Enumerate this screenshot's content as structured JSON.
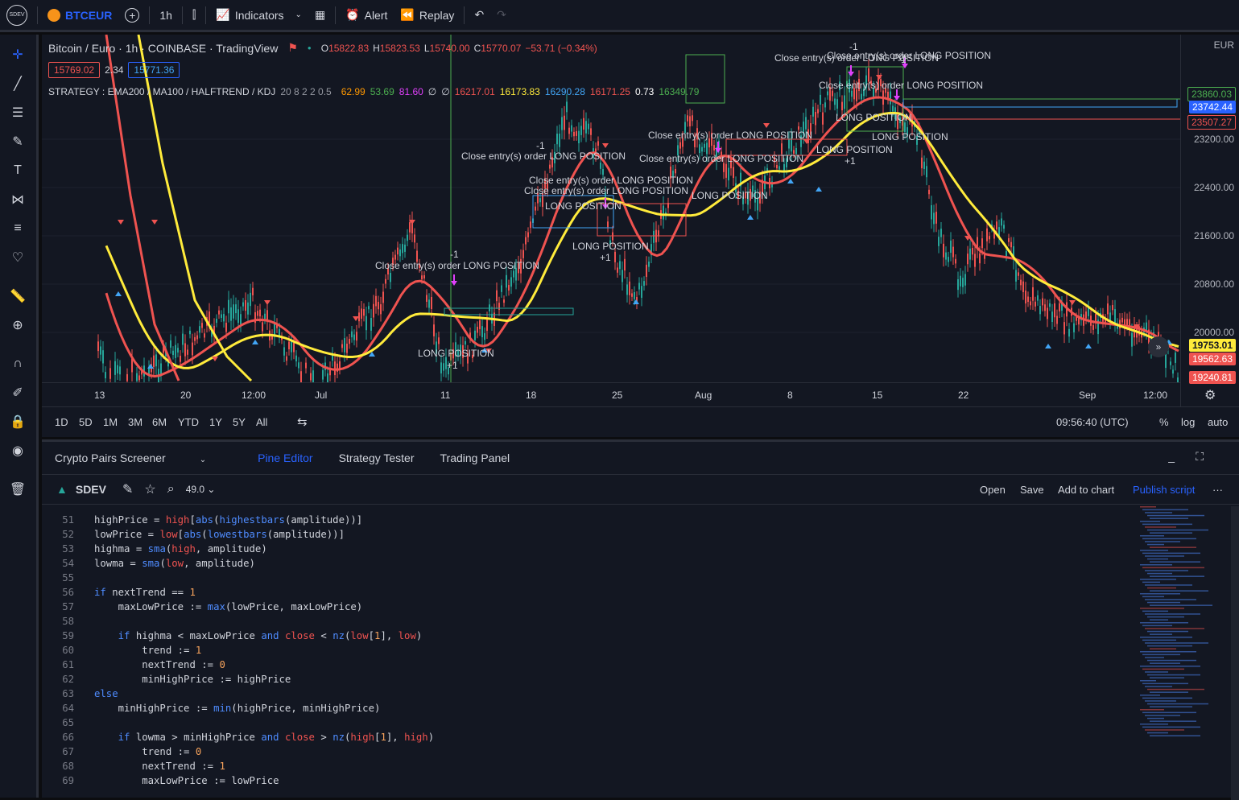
{
  "topbar": {
    "avatar": "SDEV",
    "symbol": "BTCEUR",
    "interval": "1h",
    "indicators": "Indicators",
    "alert": "Alert",
    "replay": "Replay"
  },
  "legend": {
    "title": "Bitcoin / Euro · 1h · COINBASE · TradingView",
    "o": "15822.83",
    "h": "15823.53",
    "l": "15740.00",
    "c": "15770.07",
    "chg": "−53.71 (−0.34%)",
    "bid": "15769.02",
    "spread": "2.34",
    "ask": "15771.36",
    "strategy": "STRATEGY : EMA200 / MA100 / HALFTREND / KDJ",
    "params": "20 8 2 2 0.5",
    "v1": "62.99",
    "v2": "53.69",
    "v3": "81.60",
    "v4": "∅",
    "v5": "∅",
    "v6": "16217.01",
    "v7": "16173.83",
    "v8": "16290.28",
    "v9": "16171.25",
    "v10": "0.73",
    "v11": "16349.79",
    "v1c": "#ff9800",
    "v2c": "#4caf50",
    "v3c": "#e040fb",
    "v6c": "#ef5350",
    "v7c": "#ffeb3b",
    "v8c": "#42a5f5",
    "v9c": "#ef5350",
    "v10c": "#ffffff",
    "v11c": "#4caf50"
  },
  "price_axis": {
    "currency": "EUR",
    "ticks": [
      "23200.00",
      "22400.00",
      "21600.00",
      "20800.00",
      "20000.00"
    ],
    "tag_top1": "23860.03",
    "tag_top2": "23742.44",
    "tag_top3": "23507.27",
    "tag_b1": "19753.01",
    "tag_b2": "19562.63",
    "tag_b3": "19240.81"
  },
  "time_axis": [
    "13",
    "20",
    "12:00",
    "Jul",
    "11",
    "18",
    "25",
    "Aug",
    "8",
    "15",
    "22",
    "Sep",
    "12:00"
  ],
  "labels": {
    "close": "Close entry(s) order LONG POSITION",
    "long": "LONG POSITION",
    "minus": "-1",
    "plus": "+1"
  },
  "range": {
    "items": [
      "1D",
      "5D",
      "1M",
      "3M",
      "6M",
      "YTD",
      "1Y",
      "5Y",
      "All"
    ],
    "time": "09:56:40 (UTC)",
    "pct": "%",
    "log": "log",
    "auto": "auto"
  },
  "panel": {
    "tabs": [
      "Crypto Pairs Screener",
      "Pine Editor",
      "Strategy Tester",
      "Trading Panel"
    ],
    "script": "SDEV",
    "version": "49.0",
    "open": "Open",
    "save": "Save",
    "add": "Add to chart",
    "publish": "Publish script"
  },
  "code": {
    "numbers": [
      "51",
      "52",
      "53",
      "54",
      "55",
      "56",
      "57",
      "58",
      "59",
      "60",
      "61",
      "62",
      "63",
      "64",
      "65",
      "66",
      "67",
      "68",
      "69"
    ]
  },
  "colors": {
    "bg": "#131722",
    "accent": "#2962ff",
    "ema": "#ffeb3b",
    "ma": "#ef5350",
    "up": "#26a69a",
    "down": "#ef5350"
  }
}
